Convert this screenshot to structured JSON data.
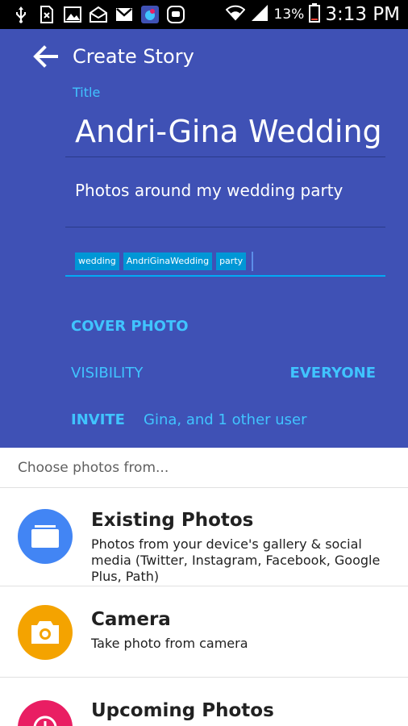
{
  "status_bar": {
    "battery_percent": "13%",
    "time": "3:13 PM",
    "icons": [
      "usb-icon",
      "sim-x-icon",
      "image-icon",
      "mail-open-icon",
      "gmail-icon",
      "app-icon",
      "messenger-icon",
      "wifi-icon",
      "signal-icon",
      "battery-icon"
    ]
  },
  "header": {
    "title": "Create Story",
    "title_field_label": "Title",
    "title_value": "Andri-Gina Wedding",
    "description_value": "Photos around my wedding party",
    "tags": [
      "wedding",
      "AndriGinaWedding",
      "party"
    ]
  },
  "settings": {
    "cover_photo_label": "COVER PHOTO",
    "visibility_label": "VISIBILITY",
    "visibility_value": "EVERYONE",
    "invite_label": "INVITE",
    "invite_value": "Gina, and 1 other user"
  },
  "sheet": {
    "header": "Choose photos from...",
    "options": [
      {
        "title": "Existing Photos",
        "subtitle": "Photos from your device's gallery & social media (Twitter, Instagram, Facebook, Google Plus, Path)",
        "icon": "gallery-icon",
        "color": "#4285f4"
      },
      {
        "title": "Camera",
        "subtitle": "Take photo from camera",
        "icon": "camera-icon",
        "color": "#f4a300"
      },
      {
        "title": "Upcoming Photos",
        "subtitle": "",
        "icon": "clock-icon",
        "color": "#e91e63"
      }
    ]
  },
  "colors": {
    "header_bg": "#3f51b5",
    "accent": "#40c4ff",
    "tag_bg": "#0097d6"
  }
}
